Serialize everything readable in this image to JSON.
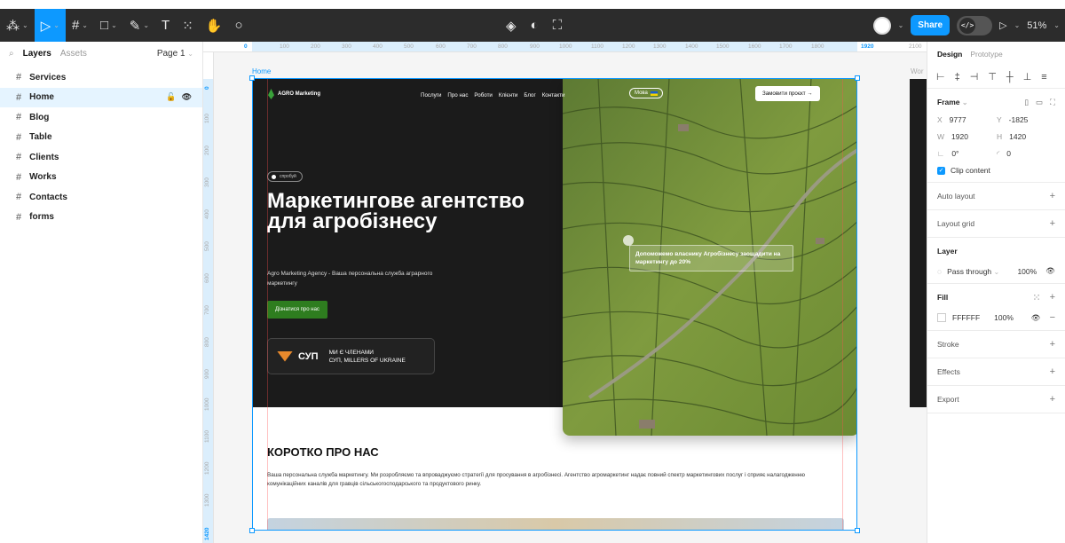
{
  "toolbar": {
    "tools": [
      {
        "name": "main-menu",
        "glyph": "⁂"
      },
      {
        "name": "move-tool",
        "glyph": "▷"
      },
      {
        "name": "frame-tool",
        "glyph": "#"
      },
      {
        "name": "shape-tool",
        "glyph": "□"
      },
      {
        "name": "pen-tool",
        "glyph": "✎"
      },
      {
        "name": "text-tool",
        "glyph": "T"
      },
      {
        "name": "resources-tool",
        "glyph": "⁙"
      },
      {
        "name": "hand-tool",
        "glyph": "✋"
      },
      {
        "name": "comment-tool",
        "glyph": "○"
      }
    ],
    "share_label": "Share",
    "code_label": "</>",
    "play_glyph": "▷",
    "zoom_label": "51%"
  },
  "left_panel": {
    "tab_layers": "Layers",
    "tab_assets": "Assets",
    "page_label": "Page 1",
    "layers": [
      "Services",
      "Home",
      "Blog",
      "Table",
      "Clients",
      "Works",
      "Contacts",
      "forms"
    ],
    "selected_layer": "Home"
  },
  "canvas": {
    "frame_label": "Home",
    "side_label": "Wor",
    "ruler_top": [
      "0",
      "100",
      "200",
      "300",
      "400",
      "500",
      "600",
      "700",
      "800",
      "900",
      "1000",
      "1100",
      "1200",
      "1300",
      "1400",
      "1500",
      "1600",
      "1700",
      "1800",
      "1920",
      "2100"
    ],
    "ruler_left": [
      "0",
      "100",
      "200",
      "300",
      "400",
      "500",
      "600",
      "700",
      "800",
      "900",
      "1000",
      "1100",
      "1200",
      "1300",
      "1420"
    ]
  },
  "site": {
    "logo": "AGRO Marketing",
    "nav": [
      "Послуги",
      "Про нас",
      "Роботи",
      "Клієнти",
      "Блог",
      "Контакти"
    ],
    "lang": "Мова",
    "order_button": "Замовити проєкт  →",
    "pill": "спробуй",
    "title": "Маркетингове агентство для агробізнесу",
    "subtitle": "Agro Marketing Agency - Ваша персональна служба аграрного маркетингу",
    "cta": "Дізнатися про нас",
    "member_logo": "СУП",
    "member_text_1": "МИ Є ЧЛЕНАМИ",
    "member_text_2": "СУП, MILLERS OF UKRAINE",
    "badge": "Допоможемо власнику Агробізнесу заощадити на маркетингу до 20%",
    "about_title": "КОРОТКО ПРО НАС",
    "about_text": "Ваша персональна служба маркетингу. Ми розробляємо та впроваджуємо стратегії для просування в агробізнесі. Агентство агромаркетинг надає повний спектр маркетингових послуг і сприяє налагодженню комунікаційних каналів для гравців сільськогосподарського та продуктового ринку."
  },
  "right_panel": {
    "tab_design": "Design",
    "tab_prototype": "Prototype",
    "frame_title": "Frame",
    "x_label": "X",
    "x_value": "9777",
    "y_label": "Y",
    "y_value": "-1825",
    "w_label": "W",
    "w_value": "1920",
    "h_label": "H",
    "h_value": "1420",
    "rotation_value": "0°",
    "radius_value": "0",
    "clip_content": "Clip content",
    "auto_layout": "Auto layout",
    "layout_grid": "Layout grid",
    "layer_title": "Layer",
    "blend_mode": "Pass through",
    "layer_opacity": "100%",
    "fill_title": "Fill",
    "fill_hex": "FFFFFF",
    "fill_opacity": "100%",
    "stroke": "Stroke",
    "effects": "Effects",
    "export": "Export"
  },
  "colors": {
    "accent": "#0d99ff",
    "toolbar_bg": "#2c2c2c",
    "hero_bg": "#1b1b1b",
    "cta_green": "#2e7d1f"
  }
}
